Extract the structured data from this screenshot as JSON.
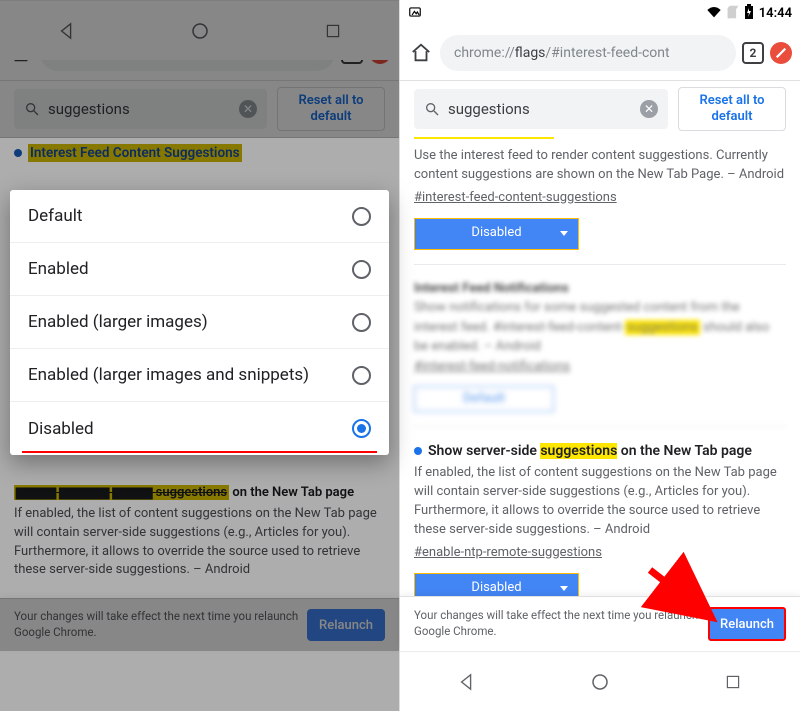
{
  "status": {
    "time": "14:44"
  },
  "toolbar": {
    "url_prefix": "chrome://",
    "url_bold": "flags",
    "url_rest": "/#interest-feed-cont",
    "tab_count": "2"
  },
  "controls": {
    "search_value": "suggestions",
    "reset_label": "Reset all to default"
  },
  "flag1": {
    "title_left": "Interest Feed Content Suggestions",
    "desc": "Use the interest feed to render content suggestions. Currently content suggestions are shown on the New Tab Page. – Android",
    "anchor": "#interest-feed-content-suggestions",
    "select_value": "Disabled"
  },
  "flag_blur": {
    "select_value": "Default"
  },
  "flag2": {
    "title_pre": "Show server-side ",
    "title_hl": "suggestions",
    "title_post": " on the New Tab page",
    "desc": "If enabled, the list of content suggestions on the New Tab page will contain server-side suggestions (e.g., Articles for you). Furthermore, it allows to override the source used to retrieve these server-side suggestions. – Android",
    "anchor": "#enable-ntp-remote-suggestions",
    "select_value": "Disabled"
  },
  "relaunch": {
    "text": "Your changes will take effect the next time you relaunch Google Chrome.",
    "button": "Relaunch"
  },
  "modal": {
    "options": [
      "Default",
      "Enabled",
      "Enabled (larger images)",
      "Enabled (larger images and snippets)",
      "Disabled"
    ]
  }
}
